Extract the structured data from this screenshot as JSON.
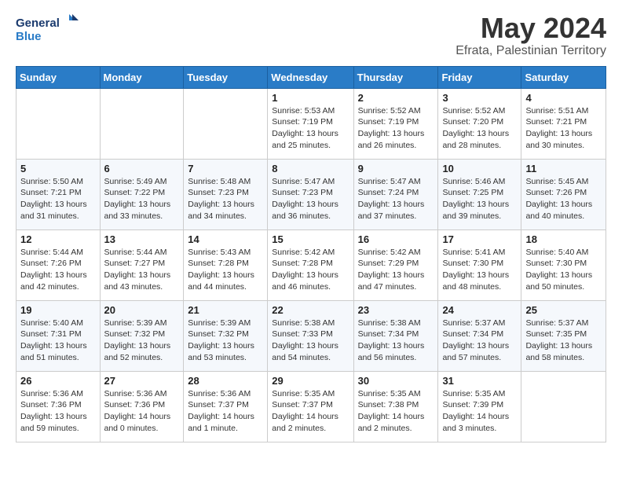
{
  "logo": {
    "line1": "General",
    "line2": "Blue"
  },
  "title": "May 2024",
  "location": "Efrata, Palestinian Territory",
  "days_of_week": [
    "Sunday",
    "Monday",
    "Tuesday",
    "Wednesday",
    "Thursday",
    "Friday",
    "Saturday"
  ],
  "weeks": [
    [
      {
        "day": "",
        "info": ""
      },
      {
        "day": "",
        "info": ""
      },
      {
        "day": "",
        "info": ""
      },
      {
        "day": "1",
        "info": "Sunrise: 5:53 AM\nSunset: 7:19 PM\nDaylight: 13 hours\nand 25 minutes."
      },
      {
        "day": "2",
        "info": "Sunrise: 5:52 AM\nSunset: 7:19 PM\nDaylight: 13 hours\nand 26 minutes."
      },
      {
        "day": "3",
        "info": "Sunrise: 5:52 AM\nSunset: 7:20 PM\nDaylight: 13 hours\nand 28 minutes."
      },
      {
        "day": "4",
        "info": "Sunrise: 5:51 AM\nSunset: 7:21 PM\nDaylight: 13 hours\nand 30 minutes."
      }
    ],
    [
      {
        "day": "5",
        "info": "Sunrise: 5:50 AM\nSunset: 7:21 PM\nDaylight: 13 hours\nand 31 minutes."
      },
      {
        "day": "6",
        "info": "Sunrise: 5:49 AM\nSunset: 7:22 PM\nDaylight: 13 hours\nand 33 minutes."
      },
      {
        "day": "7",
        "info": "Sunrise: 5:48 AM\nSunset: 7:23 PM\nDaylight: 13 hours\nand 34 minutes."
      },
      {
        "day": "8",
        "info": "Sunrise: 5:47 AM\nSunset: 7:23 PM\nDaylight: 13 hours\nand 36 minutes."
      },
      {
        "day": "9",
        "info": "Sunrise: 5:47 AM\nSunset: 7:24 PM\nDaylight: 13 hours\nand 37 minutes."
      },
      {
        "day": "10",
        "info": "Sunrise: 5:46 AM\nSunset: 7:25 PM\nDaylight: 13 hours\nand 39 minutes."
      },
      {
        "day": "11",
        "info": "Sunrise: 5:45 AM\nSunset: 7:26 PM\nDaylight: 13 hours\nand 40 minutes."
      }
    ],
    [
      {
        "day": "12",
        "info": "Sunrise: 5:44 AM\nSunset: 7:26 PM\nDaylight: 13 hours\nand 42 minutes."
      },
      {
        "day": "13",
        "info": "Sunrise: 5:44 AM\nSunset: 7:27 PM\nDaylight: 13 hours\nand 43 minutes."
      },
      {
        "day": "14",
        "info": "Sunrise: 5:43 AM\nSunset: 7:28 PM\nDaylight: 13 hours\nand 44 minutes."
      },
      {
        "day": "15",
        "info": "Sunrise: 5:42 AM\nSunset: 7:28 PM\nDaylight: 13 hours\nand 46 minutes."
      },
      {
        "day": "16",
        "info": "Sunrise: 5:42 AM\nSunset: 7:29 PM\nDaylight: 13 hours\nand 47 minutes."
      },
      {
        "day": "17",
        "info": "Sunrise: 5:41 AM\nSunset: 7:30 PM\nDaylight: 13 hours\nand 48 minutes."
      },
      {
        "day": "18",
        "info": "Sunrise: 5:40 AM\nSunset: 7:30 PM\nDaylight: 13 hours\nand 50 minutes."
      }
    ],
    [
      {
        "day": "19",
        "info": "Sunrise: 5:40 AM\nSunset: 7:31 PM\nDaylight: 13 hours\nand 51 minutes."
      },
      {
        "day": "20",
        "info": "Sunrise: 5:39 AM\nSunset: 7:32 PM\nDaylight: 13 hours\nand 52 minutes."
      },
      {
        "day": "21",
        "info": "Sunrise: 5:39 AM\nSunset: 7:32 PM\nDaylight: 13 hours\nand 53 minutes."
      },
      {
        "day": "22",
        "info": "Sunrise: 5:38 AM\nSunset: 7:33 PM\nDaylight: 13 hours\nand 54 minutes."
      },
      {
        "day": "23",
        "info": "Sunrise: 5:38 AM\nSunset: 7:34 PM\nDaylight: 13 hours\nand 56 minutes."
      },
      {
        "day": "24",
        "info": "Sunrise: 5:37 AM\nSunset: 7:34 PM\nDaylight: 13 hours\nand 57 minutes."
      },
      {
        "day": "25",
        "info": "Sunrise: 5:37 AM\nSunset: 7:35 PM\nDaylight: 13 hours\nand 58 minutes."
      }
    ],
    [
      {
        "day": "26",
        "info": "Sunrise: 5:36 AM\nSunset: 7:36 PM\nDaylight: 13 hours\nand 59 minutes."
      },
      {
        "day": "27",
        "info": "Sunrise: 5:36 AM\nSunset: 7:36 PM\nDaylight: 14 hours\nand 0 minutes."
      },
      {
        "day": "28",
        "info": "Sunrise: 5:36 AM\nSunset: 7:37 PM\nDaylight: 14 hours\nand 1 minute."
      },
      {
        "day": "29",
        "info": "Sunrise: 5:35 AM\nSunset: 7:37 PM\nDaylight: 14 hours\nand 2 minutes."
      },
      {
        "day": "30",
        "info": "Sunrise: 5:35 AM\nSunset: 7:38 PM\nDaylight: 14 hours\nand 2 minutes."
      },
      {
        "day": "31",
        "info": "Sunrise: 5:35 AM\nSunset: 7:39 PM\nDaylight: 14 hours\nand 3 minutes."
      },
      {
        "day": "",
        "info": ""
      }
    ]
  ]
}
